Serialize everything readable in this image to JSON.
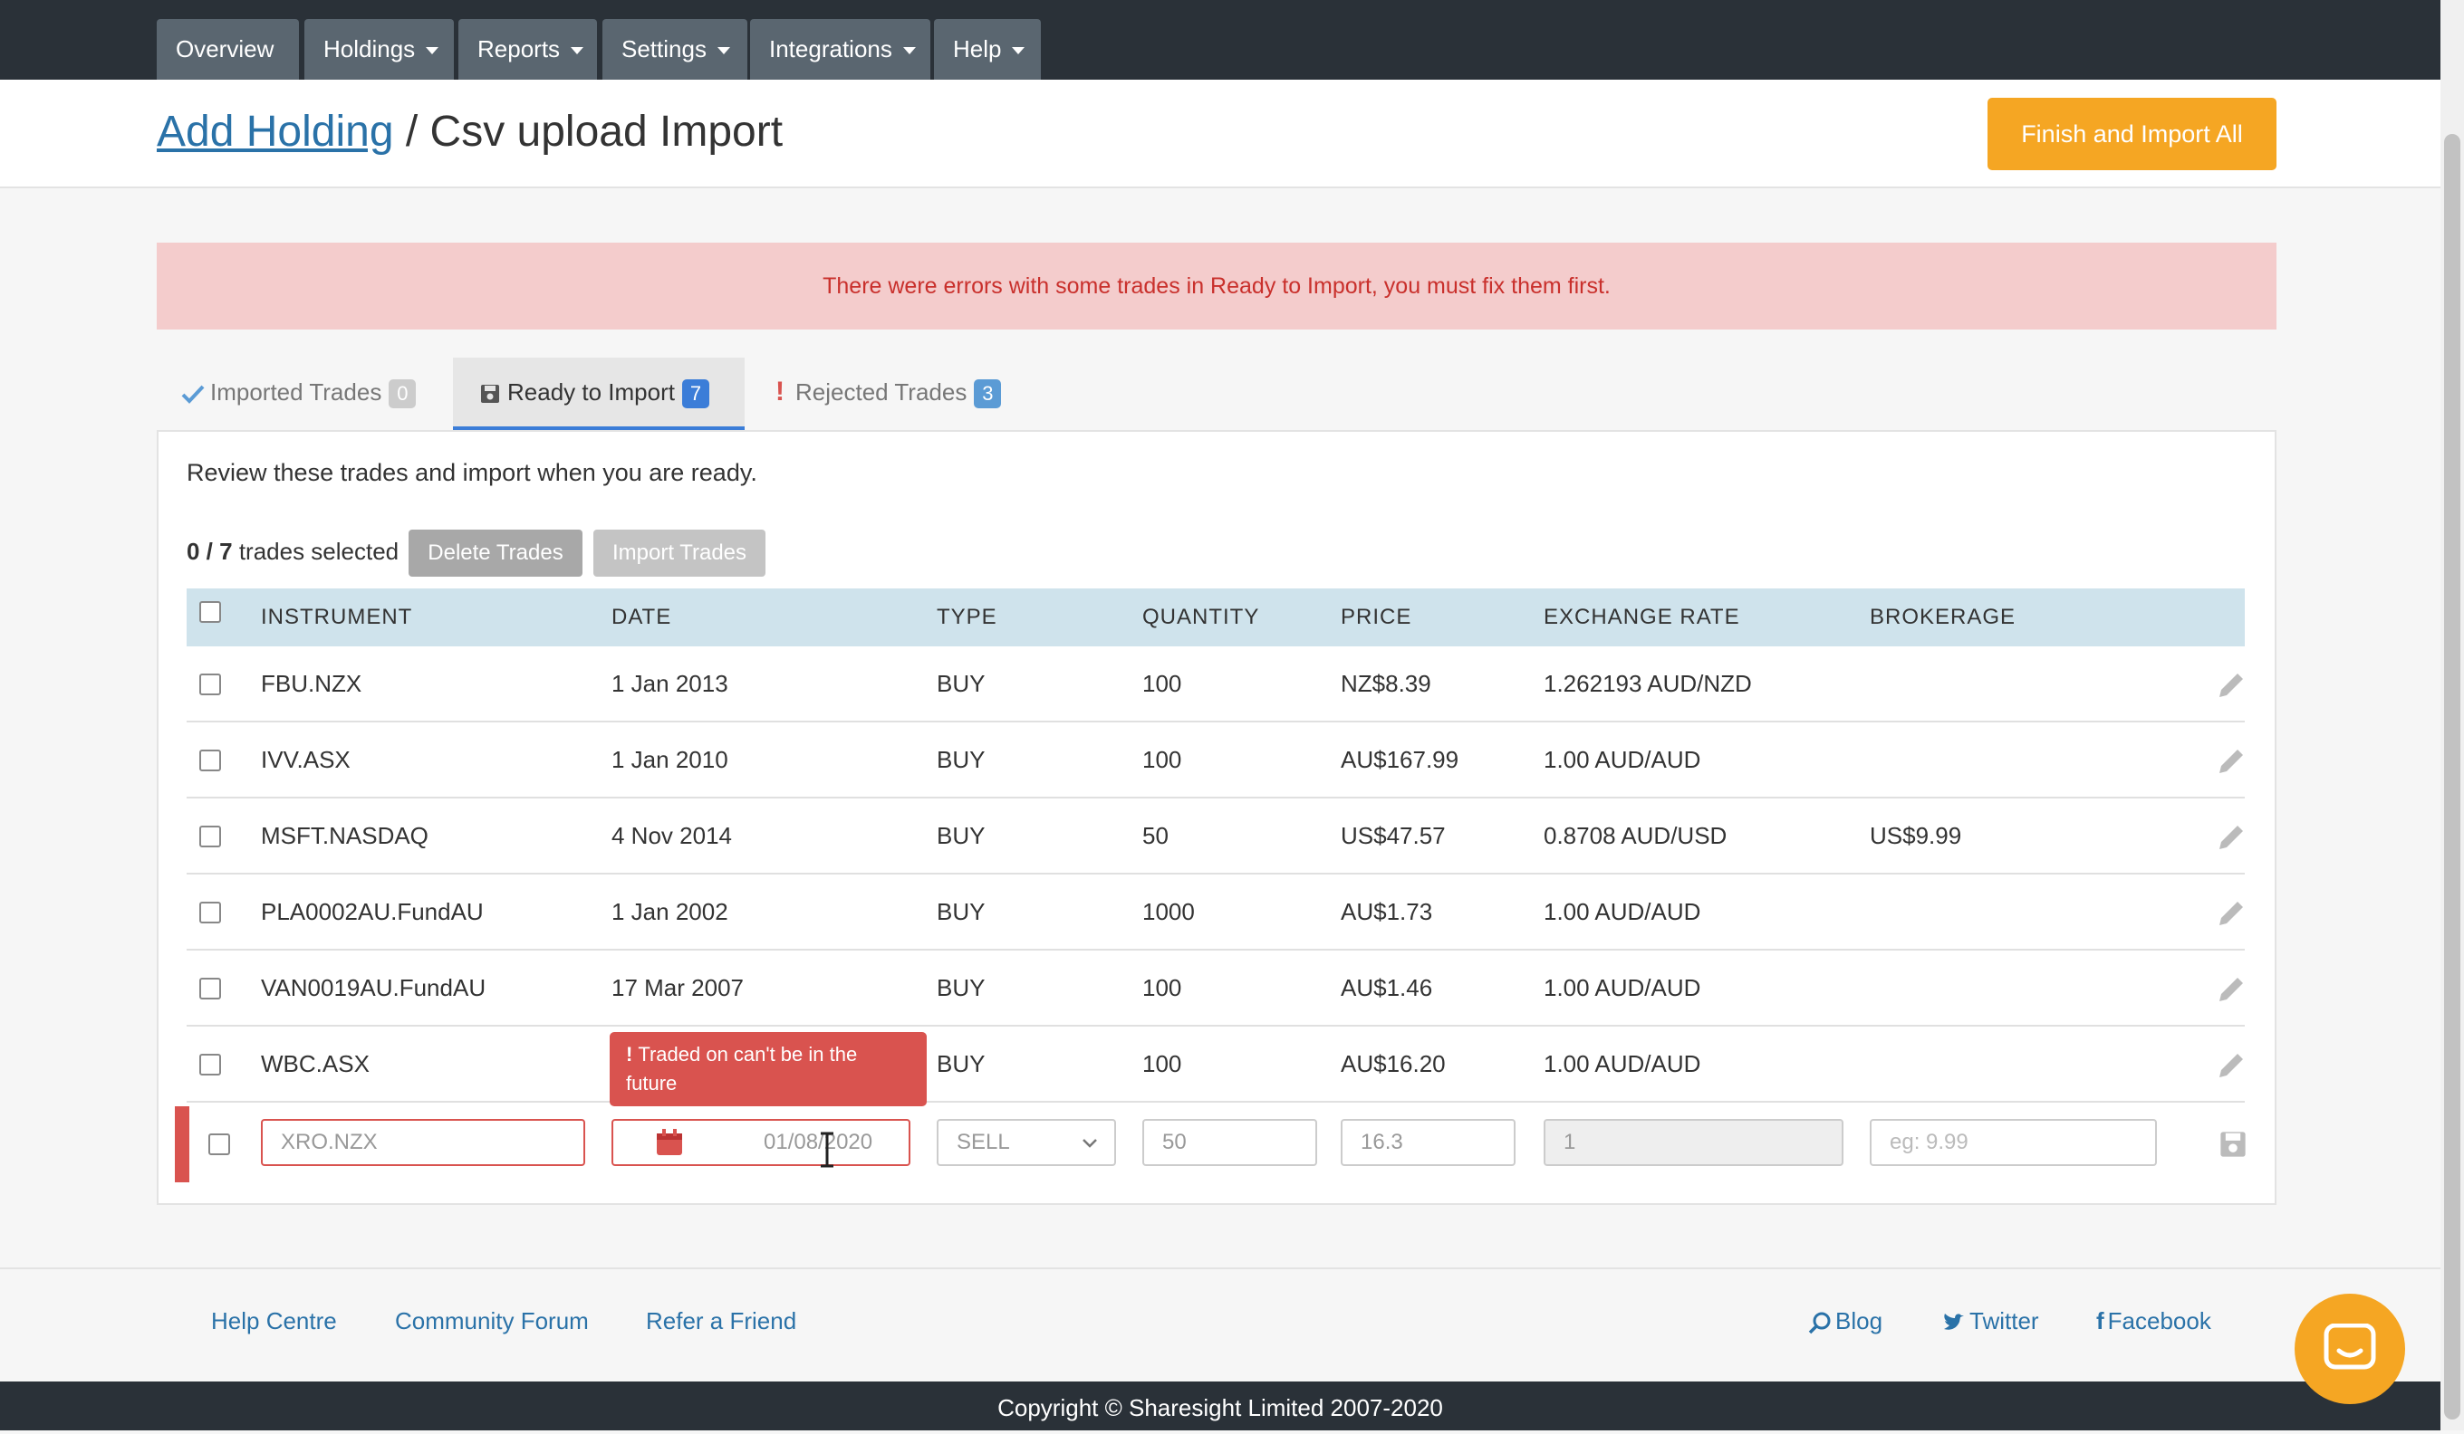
{
  "nav": {
    "items": [
      {
        "label": "Overview",
        "dropdown": false
      },
      {
        "label": "Holdings",
        "dropdown": true
      },
      {
        "label": "Reports",
        "dropdown": true
      },
      {
        "label": "Settings",
        "dropdown": true
      },
      {
        "label": "Integrations",
        "dropdown": true
      },
      {
        "label": "Help",
        "dropdown": true
      }
    ]
  },
  "header": {
    "breadcrumb_link": "Add Holding",
    "separator": " / ",
    "title": "Csv upload Import",
    "finish_button": "Finish and Import All"
  },
  "alert": {
    "text": "There were errors with some trades in Ready to Import, you must fix them first."
  },
  "tabs": [
    {
      "label": "Imported Trades",
      "count": "0",
      "icon": "check-icon"
    },
    {
      "label": "Ready to Import",
      "count": "7",
      "icon": "save-icon"
    },
    {
      "label": "Rejected Trades",
      "count": "3",
      "icon": "exclamation-icon"
    }
  ],
  "panel": {
    "review_text": "Review these trades and import when you are ready.",
    "selected_count": "0 / 7",
    "selected_suffix": " trades selected",
    "delete_button": "Delete Trades",
    "import_button": "Import Trades"
  },
  "table": {
    "columns": [
      "INSTRUMENT",
      "DATE",
      "TYPE",
      "QUANTITY",
      "PRICE",
      "EXCHANGE RATE",
      "BROKERAGE"
    ],
    "rows": [
      {
        "instrument": "FBU.NZX",
        "date": "1 Jan 2013",
        "type": "BUY",
        "quantity": "100",
        "price": "NZ$8.39",
        "exchange_rate": "1.262193 AUD/NZD",
        "brokerage": ""
      },
      {
        "instrument": "IVV.ASX",
        "date": "1 Jan 2010",
        "type": "BUY",
        "quantity": "100",
        "price": "AU$167.99",
        "exchange_rate": "1.00 AUD/AUD",
        "brokerage": ""
      },
      {
        "instrument": "MSFT.NASDAQ",
        "date": "4 Nov 2014",
        "type": "BUY",
        "quantity": "50",
        "price": "US$47.57",
        "exchange_rate": "0.8708 AUD/USD",
        "brokerage": "US$9.99"
      },
      {
        "instrument": "PLA0002AU.FundAU",
        "date": "1 Jan 2002",
        "type": "BUY",
        "quantity": "1000",
        "price": "AU$1.73",
        "exchange_rate": "1.00 AUD/AUD",
        "brokerage": ""
      },
      {
        "instrument": "VAN0019AU.FundAU",
        "date": "17 Mar 2007",
        "type": "BUY",
        "quantity": "100",
        "price": "AU$1.46",
        "exchange_rate": "1.00 AUD/AUD",
        "brokerage": ""
      },
      {
        "instrument": "WBC.ASX",
        "date": "",
        "type": "BUY",
        "quantity": "100",
        "price": "AU$16.20",
        "exchange_rate": "1.00 AUD/AUD",
        "brokerage": ""
      }
    ],
    "edit_row": {
      "instrument": "XRO.NZX",
      "date": "01/08/2020",
      "type": "SELL",
      "quantity": "50",
      "price": "16.3",
      "exchange_rate": "1",
      "brokerage_placeholder": "eg: 9.99",
      "error": "Traded on can't be in the future"
    }
  },
  "footer": {
    "links": [
      "Help Centre",
      "Community Forum",
      "Refer a Friend"
    ],
    "social": [
      "Blog",
      "Twitter",
      "Facebook"
    ],
    "copyright": "Copyright © Sharesight Limited 2007-2020"
  },
  "colors": {
    "accent": "#f5a623",
    "nav": "#2a3138",
    "error": "#d9534f",
    "link": "#2a72a8",
    "badge_blue": "#3b7dd8"
  }
}
